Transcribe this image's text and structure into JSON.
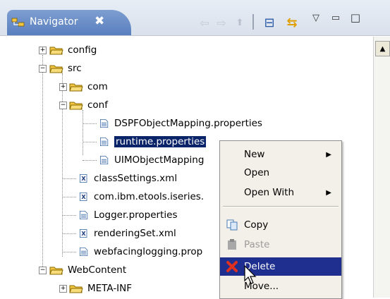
{
  "view": {
    "tab_title": "Navigator",
    "close_glyph": "✖"
  },
  "toolbar": {
    "back_icon": "⇦",
    "forward_icon": "⇨",
    "up_icon": "⬆",
    "collapse_all_icon": "⊟",
    "link_editor_icon": "⇆",
    "menu_icon": "▽",
    "minimize_icon": "▭",
    "maximize_icon": "□"
  },
  "tree": {
    "items": [
      {
        "label": "config"
      },
      {
        "label": "src"
      },
      {
        "label": "com"
      },
      {
        "label": "conf"
      },
      {
        "label": "DSPFObjectMapping.properties"
      },
      {
        "label": "runtime.properties"
      },
      {
        "label": "UIMObjectMapping"
      },
      {
        "label": "classSettings.xml"
      },
      {
        "label": "com.ibm.etools.iseries."
      },
      {
        "label": "Logger.properties"
      },
      {
        "label": "renderingSet.xml"
      },
      {
        "label": "webfacinglogging.prop"
      },
      {
        "label": "WebContent"
      },
      {
        "label": "META-INF"
      }
    ],
    "selected": "runtime.properties"
  },
  "context_menu": {
    "new": "New",
    "open": "Open",
    "open_with": "Open With",
    "copy": "Copy",
    "paste": "Paste",
    "delete": "Delete",
    "move": "Move..."
  },
  "colors": {
    "tab_active": "#5a7fbf",
    "selection": "#0a246a",
    "menu_highlight": "#1f2f8f",
    "folder": "#f2c640"
  }
}
